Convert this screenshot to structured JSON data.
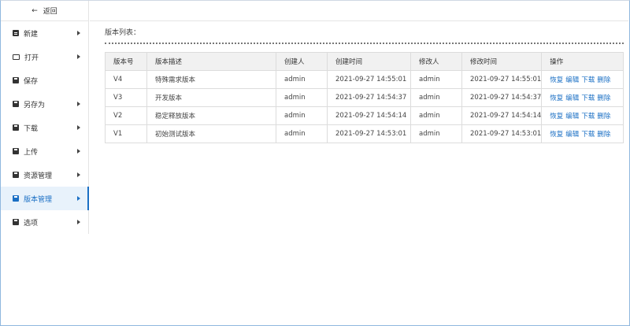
{
  "sidebar": {
    "back_label": "返回",
    "items": [
      {
        "label": "新建",
        "icon": "file-icon"
      },
      {
        "label": "打开",
        "icon": "folder-icon"
      },
      {
        "label": "保存",
        "icon": "save-icon"
      },
      {
        "label": "另存为",
        "icon": "save-as-icon"
      },
      {
        "label": "下载",
        "icon": "download-icon"
      },
      {
        "label": "上传",
        "icon": "upload-icon"
      },
      {
        "label": "资源管理",
        "icon": "resource-icon"
      },
      {
        "label": "版本管理",
        "icon": "version-icon",
        "active": true
      },
      {
        "label": "选项",
        "icon": "options-icon"
      }
    ]
  },
  "main": {
    "section_title": "版本列表：",
    "table": {
      "headers": [
        "版本号",
        "版本描述",
        "创建人",
        "创建时间",
        "修改人",
        "修改时间",
        "操作"
      ],
      "rows": [
        {
          "version": "V4",
          "desc": "特殊需求版本",
          "creator": "admin",
          "created": "2021-09-27 14:55:01",
          "modifier": "admin",
          "modified": "2021-09-27 14:55:01"
        },
        {
          "version": "V3",
          "desc": "开发版本",
          "creator": "admin",
          "created": "2021-09-27 14:54:37",
          "modifier": "admin",
          "modified": "2021-09-27 14:54:37"
        },
        {
          "version": "V2",
          "desc": "稳定释放版本",
          "creator": "admin",
          "created": "2021-09-27 14:54:14",
          "modifier": "admin",
          "modified": "2021-09-27 14:54:14"
        },
        {
          "version": "V1",
          "desc": "初始测试版本",
          "creator": "admin",
          "created": "2021-09-27 14:53:01",
          "modifier": "admin",
          "modified": "2021-09-27 14:53:01"
        }
      ],
      "actions": {
        "restore": "恢复",
        "edit": "编辑",
        "download": "下载",
        "delete": "删除"
      }
    }
  },
  "colors": {
    "accent": "#1a6fc4",
    "active_bg": "#e8f2fb",
    "header_bg": "#f1f1f1"
  }
}
